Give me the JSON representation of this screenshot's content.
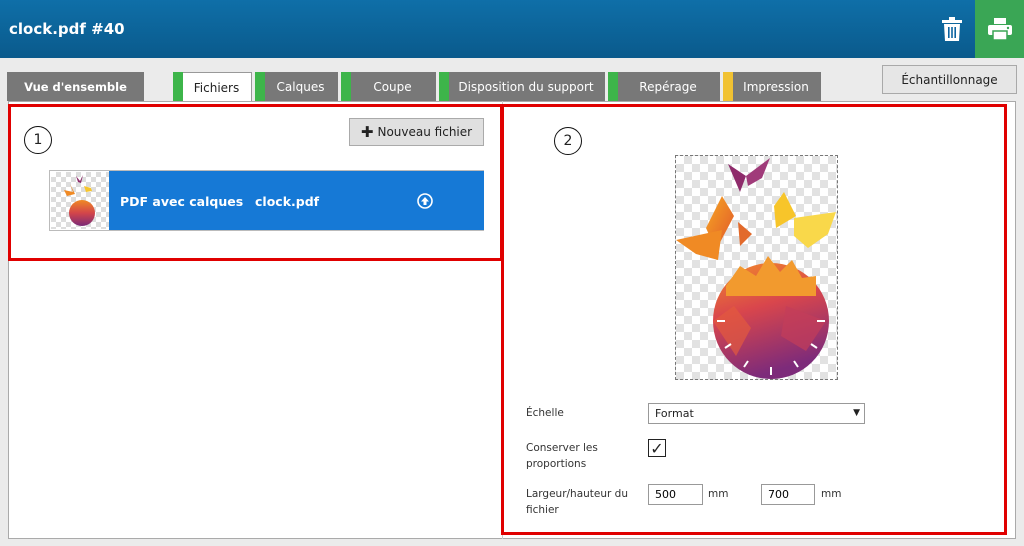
{
  "header": {
    "title": "clock.pdf #40"
  },
  "icons": {
    "trash": "trash-icon",
    "print": "printer-icon",
    "upload": "upload-icon",
    "plus": "plus-icon"
  },
  "colors": {
    "header": "#0a5a8c",
    "print_button": "#3aa655",
    "file_row": "#1679d6",
    "highlight": "#e00000",
    "tab_green": "#3db54a",
    "tab_yellow": "#f1c232"
  },
  "tabs": [
    {
      "label": "Vue d'ensemble",
      "status": "none"
    },
    {
      "label": "Fichiers",
      "status": "green",
      "active": true
    },
    {
      "label": "Calques",
      "status": "green"
    },
    {
      "label": "Coupe",
      "status": "green"
    },
    {
      "label": "Disposition du support",
      "status": "green"
    },
    {
      "label": "Repérage",
      "status": "green"
    },
    {
      "label": "Impression",
      "status": "yellow"
    }
  ],
  "sample_button": "Échantillonnage",
  "panel1": {
    "marker": "1",
    "new_file_button": "Nouveau fichier",
    "file": {
      "type": "PDF avec calques",
      "name": "clock.pdf"
    }
  },
  "panel2": {
    "marker": "2",
    "scale_label": "Échelle",
    "scale_value": "Format",
    "keep_proportions_label_line1": "Conserver les",
    "keep_proportions_label_line2": "proportions",
    "keep_proportions_mark": "✓",
    "size_label_line1": "Largeur/hauteur du",
    "size_label_line2": "fichier",
    "width_value": "500",
    "height_value": "700",
    "unit": "mm"
  }
}
